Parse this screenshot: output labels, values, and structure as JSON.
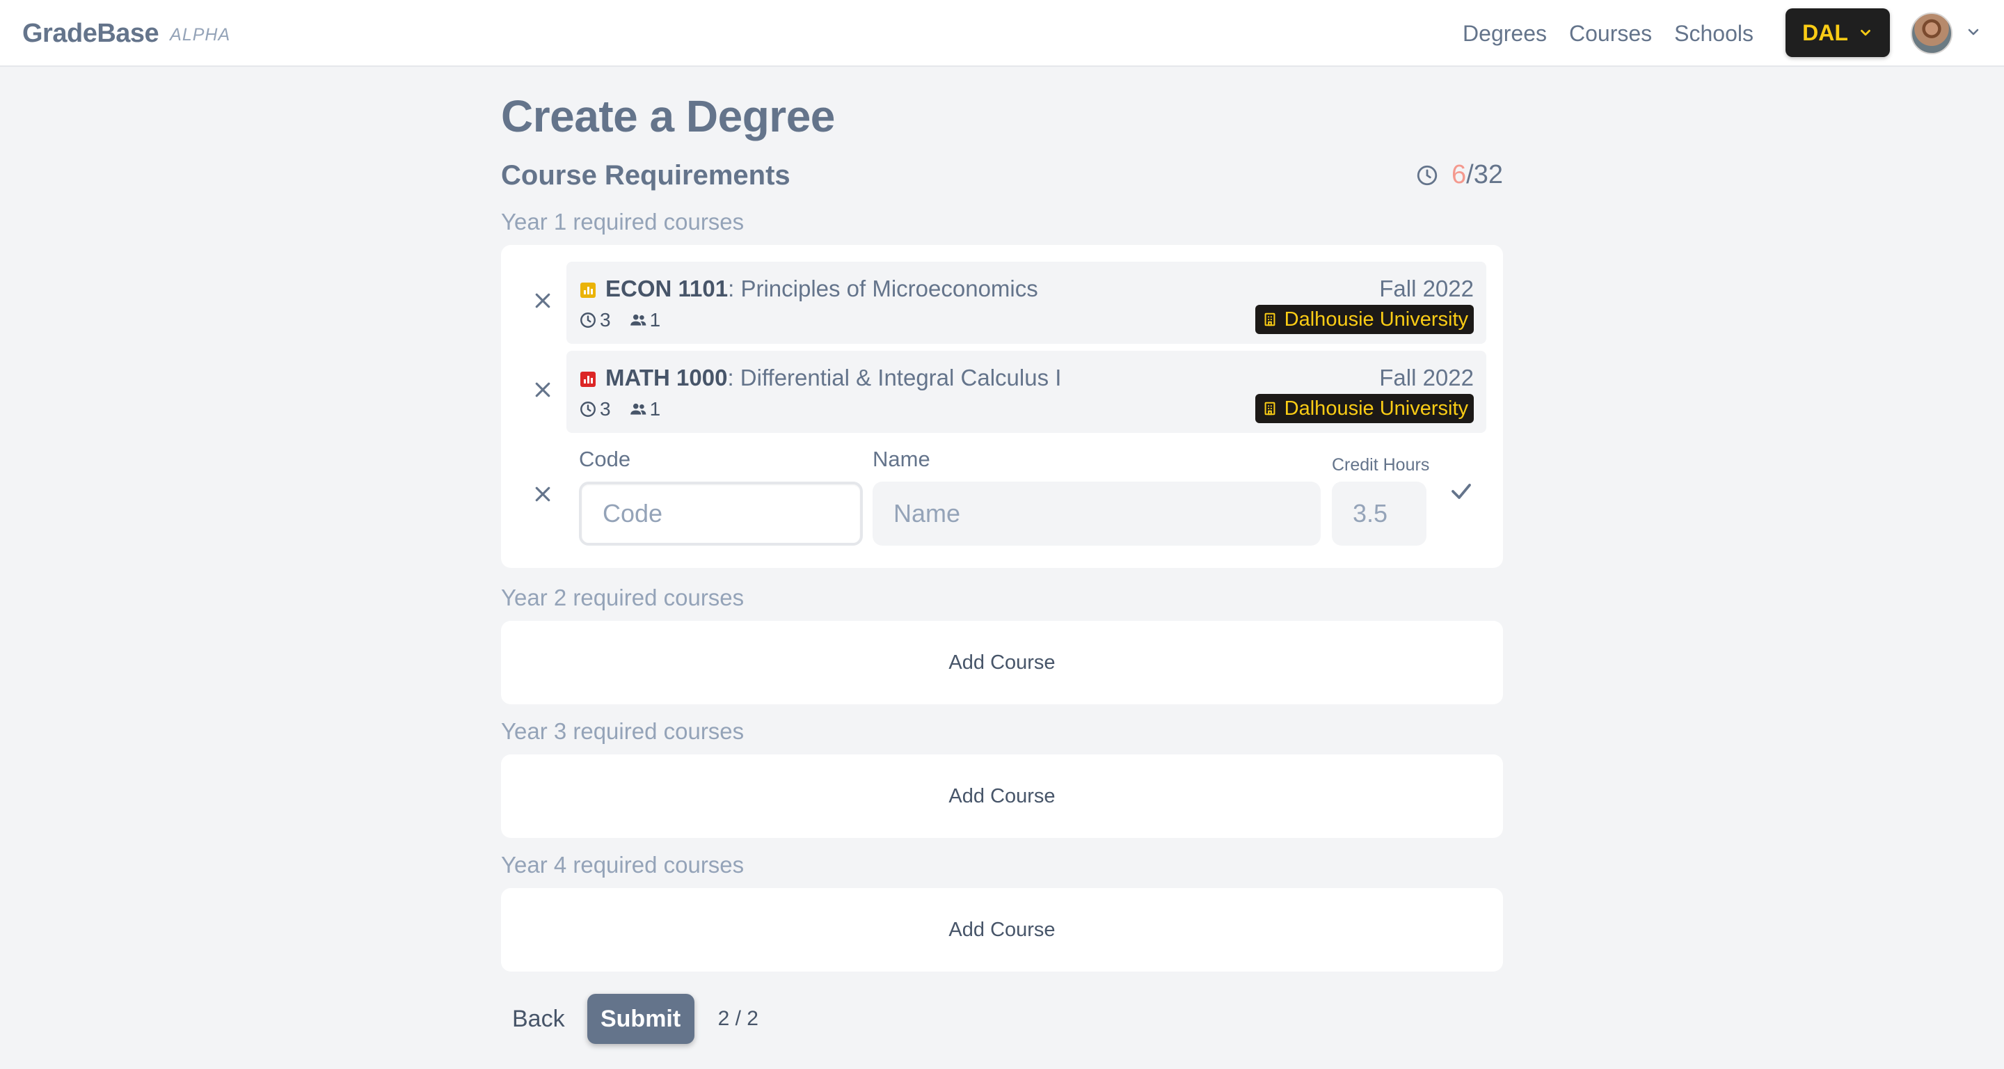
{
  "app": {
    "name": "GradeBase",
    "tag": "ALPHA"
  },
  "nav": {
    "links": [
      "Degrees",
      "Courses",
      "Schools"
    ],
    "school_code": "DAL"
  },
  "page": {
    "title": "Create a Degree",
    "section_title": "Course Requirements",
    "hours_current": "6",
    "hours_total": "/32"
  },
  "years": [
    {
      "label": "Year 1 required courses"
    },
    {
      "label": "Year 2 required courses",
      "add_label": "Add Course"
    },
    {
      "label": "Year 3 required courses",
      "add_label": "Add Course"
    },
    {
      "label": "Year 4 required courses",
      "add_label": "Add Course"
    }
  ],
  "courses": [
    {
      "code": "ECON 1101",
      "name": ": Principles of Microeconomics",
      "credit_hours": "3",
      "students": "1",
      "term": "Fall 2022",
      "school": "Dalhousie University",
      "icon_color": "#eab308",
      "icon": "chart-icon"
    },
    {
      "code": "MATH 1000",
      "name": ": Differential & Integral Calculus I",
      "credit_hours": "3",
      "students": "1",
      "term": "Fall 2022",
      "school": "Dalhousie University",
      "icon_color": "#dc2626",
      "icon": "chart-icon"
    }
  ],
  "new_course_form": {
    "code_label": "Code",
    "code_placeholder": "Code",
    "name_label": "Name",
    "name_placeholder": "Name",
    "hours_label": "Credit Hours",
    "hours_placeholder": "3.5"
  },
  "footer": {
    "back_label": "Back",
    "submit_label": "Submit",
    "step": "2 / 2"
  },
  "colors": {
    "accent": "#64748b",
    "school_badge_bg": "#1c1917",
    "school_badge_text": "#facc15",
    "hours_current": "#f4998e"
  }
}
